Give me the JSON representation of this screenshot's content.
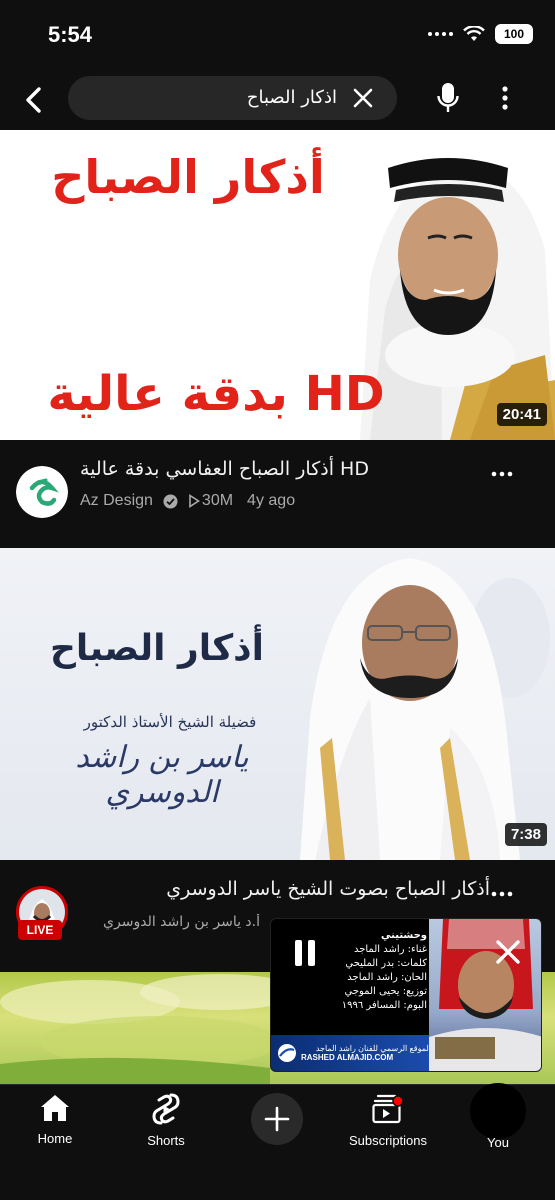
{
  "status_bar": {
    "time": "5:54",
    "battery": "100"
  },
  "search": {
    "query": "اذكار الصباح"
  },
  "videos": [
    {
      "thumbnail_text_top": "أذكار الصباح",
      "thumbnail_text_bottom": "بدقة عالية HD",
      "duration": "20:41",
      "title": "أذكار الصباح العفاسي بدقة عالية HD",
      "channel": "Az Design",
      "views": "30M",
      "age": "4y ago",
      "verified": true
    },
    {
      "thumbnail_text_top": "أذكار الصباح",
      "thumbnail_text_sub": "فضيلة الشيخ الأستاذ الدكتور",
      "thumbnail_text_name": "ياسر بن راشد الدوسري",
      "duration": "7:38",
      "title": "أذكار الصباح  بصوت الشيخ ياسر الدوسري",
      "channel": "أ.د ياسر بن راشد الدوسري",
      "live_badge": "LIVE"
    }
  ],
  "mini_player": {
    "lines": [
      "وحشتيني",
      "غناء: راشد الماجد",
      "كلمات: بدر المليحي",
      "الحان: راشد الماجد",
      "توزيع: يحيى الموجي",
      "البوم: المسافر ١٩٩٦"
    ],
    "footer_line1": "الموقع الرسمي للفنان راشد الماجد",
    "footer_line2": "RASHED ALMAJID.COM"
  },
  "bottom_nav": {
    "home": "Home",
    "shorts": "Shorts",
    "subscriptions": "Subscriptions",
    "you": "You"
  },
  "colors": {
    "background": "#0f0f0f",
    "thumb_red_text": "#e2231a",
    "live_red": "#cc0000",
    "secondary_text": "#aaaaaa"
  }
}
